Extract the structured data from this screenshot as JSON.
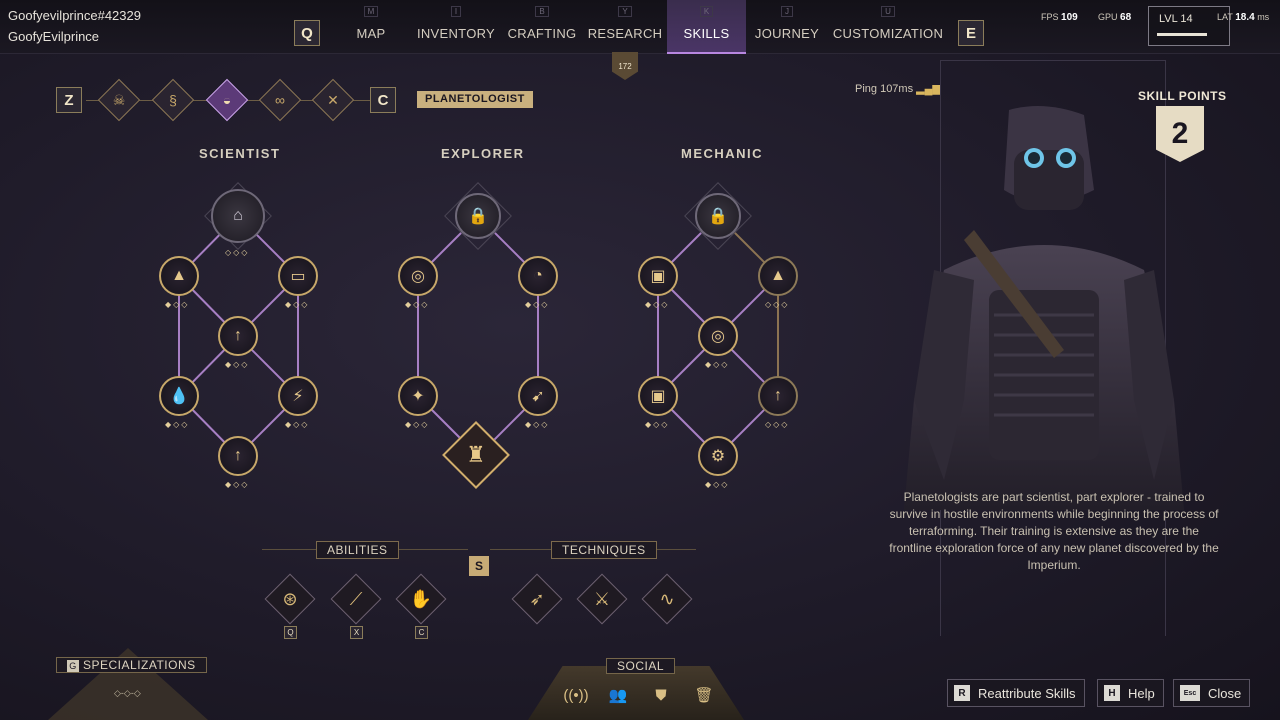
{
  "player": {
    "id": "Goofyevilprince#42329",
    "name": "GoofyEvilprince"
  },
  "nav": {
    "left_key": "Q",
    "right_key": "E",
    "tabs": [
      {
        "key": "M",
        "label": "MAP"
      },
      {
        "key": "I",
        "label": "INVENTORY"
      },
      {
        "key": "B",
        "label": "CRAFTING"
      },
      {
        "key": "Y",
        "label": "RESEARCH"
      },
      {
        "key": "K",
        "label": "SKILLS",
        "active": true
      },
      {
        "key": "J",
        "label": "JOURNEY"
      },
      {
        "key": "U",
        "label": "CUSTOMIZATION"
      }
    ],
    "center_badge": "172"
  },
  "stats": {
    "fps_label": "FPS",
    "fps": "109",
    "gpu_label": "GPU",
    "gpu": "68",
    "lvl_label": "LVL",
    "lvl": "14",
    "lat_label": "LAT",
    "lat": "18.4",
    "lat_unit": "ms"
  },
  "specs": {
    "left_key": "Z",
    "right_key": "C",
    "active_label": "PLANETOLOGIST",
    "icons": [
      "skull-icon",
      "swirl-icon",
      "planetologist-icon",
      "goggles-icon",
      "crossed-tools-icon"
    ]
  },
  "ping": "Ping 107ms",
  "skill_points": {
    "title": "SKILL POINTS",
    "value": "2"
  },
  "trees": [
    {
      "title": "SCIENTIST"
    },
    {
      "title": "EXPLORER"
    },
    {
      "title": "MECHANIC"
    }
  ],
  "sections": {
    "abilities": "ABILITIES",
    "techniques": "TECHNIQUES",
    "s_key": "S"
  },
  "ability_keys": [
    "Q",
    "X",
    "C"
  ],
  "specializations": {
    "key": "G",
    "label": "SPECIALIZATIONS",
    "status": "◇-◇-◇"
  },
  "social": {
    "label": "SOCIAL"
  },
  "buttons": [
    {
      "key": "R",
      "label": "Reattribute Skills"
    },
    {
      "key": "H",
      "label": "Help"
    },
    {
      "key": "Esc",
      "label": "Close"
    }
  ],
  "description": "Planetologists are part scientist, part explorer - trained to survive in hostile environments while beginning the process of terraforming. Their training is extensive as they are the frontline exploration force of any new planet discovered by the Imperium."
}
